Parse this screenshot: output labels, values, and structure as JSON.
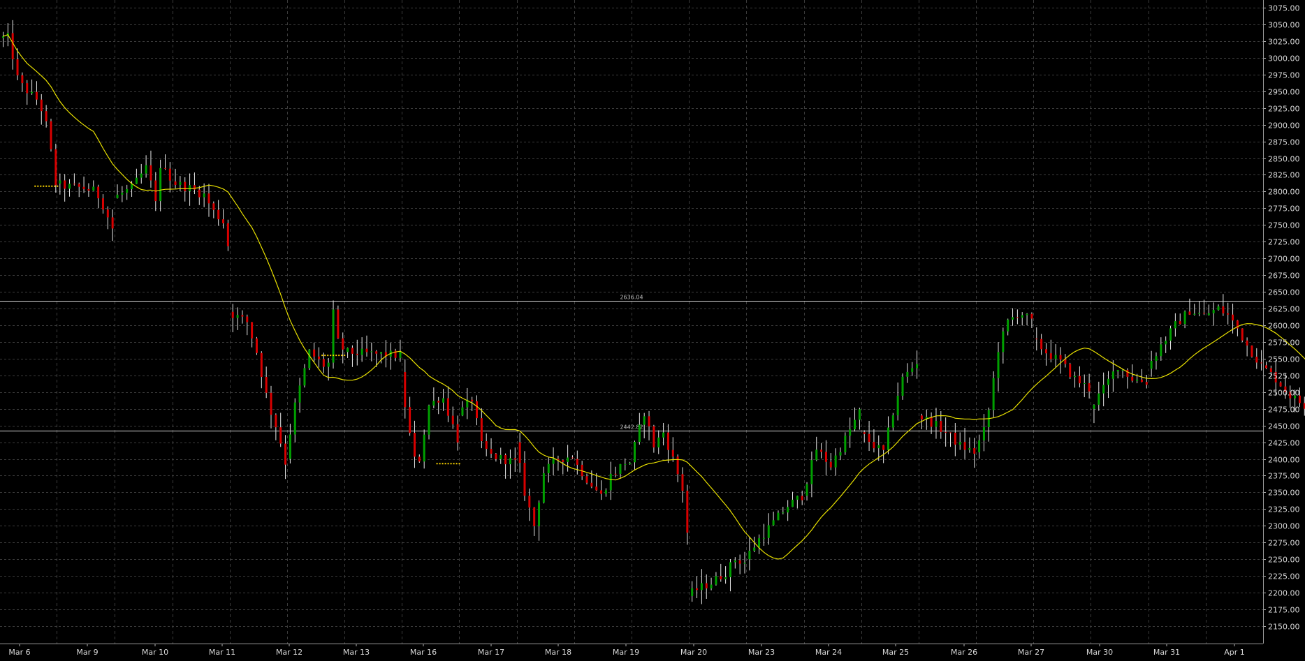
{
  "colors": {
    "background": "#000000",
    "grid": "#3c3c3c",
    "bull": "#00a000",
    "bear": "#d80000",
    "wick": "#e8e8e8",
    "ma": "#e8e000",
    "gap": "#ffd800",
    "level": "#d8d8d8",
    "axis_text": "#d8d8d8"
  },
  "chart_data": {
    "type": "candlestick",
    "ylim": [
      2150,
      3075
    ],
    "y_ticks": [
      "3075.00",
      "3050.00",
      "3025.00",
      "3000.00",
      "2975.00",
      "2950.00",
      "2925.00",
      "2900.00",
      "2875.00",
      "2850.00",
      "2825.00",
      "2800.00",
      "2775.00",
      "2750.00",
      "2725.00",
      "2700.00",
      "2675.00",
      "2650.00",
      "2625.00",
      "2600.00",
      "2575.00",
      "2550.00",
      "2525.00",
      "2500.00",
      "2475.00",
      "2450.00",
      "2425.00",
      "2400.00",
      "2375.00",
      "2350.00",
      "2325.00",
      "2300.00",
      "2275.00",
      "2250.00",
      "2225.00",
      "2200.00",
      "2175.00",
      "2150.00"
    ],
    "sessions": [
      "Mar 6",
      "Mar 9",
      "Mar 10",
      "Mar 11",
      "Mar 12",
      "Mar 13",
      "Mar 16",
      "Mar 17",
      "Mar 18",
      "Mar 19",
      "Mar 20",
      "Mar 23",
      "Mar 24",
      "Mar 25",
      "Mar 26",
      "Mar 27",
      "Mar 30",
      "Mar 31",
      "Apr 1"
    ],
    "horizontal_lines": [
      {
        "value": 2636.04,
        "label": "2636.04"
      },
      {
        "value": 2442.82,
        "label": "2442.82"
      }
    ],
    "session_path": [
      [
        [
          2.5,
          3030
        ],
        [
          3.5,
          2975
        ],
        [
          5,
          2958
        ],
        [
          6.8,
          2945
        ],
        [
          8.5,
          2935
        ],
        [
          10,
          2900
        ],
        [
          11.7,
          2830
        ],
        [
          12,
          2812
        ]
      ],
      [
        [
          0,
          2812
        ],
        [
          2,
          2808
        ],
        [
          6,
          2805
        ],
        [
          8.5,
          2800
        ],
        [
          10,
          2780
        ],
        [
          12,
          2745
        ]
      ],
      [
        [
          0,
          2790
        ],
        [
          4,
          2805
        ],
        [
          7,
          2835
        ],
        [
          9,
          2790
        ],
        [
          10.5,
          2850
        ],
        [
          12,
          2820
        ]
      ],
      [
        [
          0,
          2815
        ],
        [
          4,
          2805
        ],
        [
          7,
          2795
        ],
        [
          9,
          2770
        ],
        [
          11,
          2755
        ],
        [
          12,
          2720
        ]
      ],
      [
        [
          0,
          2620
        ],
        [
          4,
          2605
        ],
        [
          6,
          2560
        ],
        [
          8.5,
          2480
        ],
        [
          10.5,
          2440
        ],
        [
          12,
          2395
        ]
      ],
      [
        [
          0,
          2400
        ],
        [
          2,
          2480
        ],
        [
          5,
          2560
        ],
        [
          8,
          2540
        ],
        [
          9.8,
          2545
        ],
        [
          10.2,
          2690
        ],
        [
          11,
          2575
        ],
        [
          12,
          2565
        ]
      ],
      [
        [
          0,
          2560
        ],
        [
          6,
          2557
        ],
        [
          12,
          2555
        ]
      ],
      [
        [
          0,
          2530
        ],
        [
          1.5,
          2455
        ],
        [
          3.5,
          2380
        ],
        [
          6,
          2480
        ],
        [
          8.8,
          2495
        ],
        [
          10,
          2470
        ],
        [
          12,
          2430
        ]
      ],
      [
        [
          0,
          2465
        ],
        [
          3,
          2490
        ],
        [
          5,
          2420
        ],
        [
          7,
          2405
        ],
        [
          9.5,
          2400
        ],
        [
          12,
          2395
        ]
      ],
      [
        [
          0,
          2425
        ],
        [
          2,
          2350
        ],
        [
          4,
          2300
        ],
        [
          6,
          2380
        ],
        [
          9,
          2400
        ],
        [
          12,
          2405
        ]
      ],
      [
        [
          0,
          2400
        ],
        [
          3,
          2370
        ],
        [
          6,
          2345
        ],
        [
          8,
          2375
        ],
        [
          11,
          2395
        ],
        [
          12,
          2395
        ]
      ],
      [
        [
          0,
          2395
        ],
        [
          3,
          2470
        ],
        [
          5,
          2420
        ],
        [
          7,
          2440
        ],
        [
          9,
          2400
        ],
        [
          11,
          2355
        ],
        [
          12,
          2290
        ]
      ],
      [
        [
          0,
          2195
        ],
        [
          2,
          2205
        ],
        [
          5,
          2215
        ],
        [
          8,
          2230
        ],
        [
          10,
          2250
        ],
        [
          12,
          2245
        ]
      ],
      [
        [
          0,
          2250
        ],
        [
          3,
          2280
        ],
        [
          6,
          2305
        ],
        [
          9,
          2330
        ],
        [
          12,
          2345
        ]
      ],
      [
        [
          0,
          2345
        ],
        [
          3,
          2415
        ],
        [
          6,
          2390
        ],
        [
          9,
          2430
        ],
        [
          12,
          2470
        ]
      ],
      [
        [
          0,
          2440
        ],
        [
          3,
          2420
        ],
        [
          5,
          2410
        ],
        [
          7.5,
          2485
        ],
        [
          9,
          2520
        ],
        [
          12,
          2545
        ]
      ],
      [
        [
          0,
          2465
        ],
        [
          3,
          2455
        ],
        [
          6,
          2440
        ],
        [
          9,
          2420
        ],
        [
          12,
          2410
        ]
      ],
      [
        [
          0,
          2410
        ],
        [
          2.5,
          2450
        ],
        [
          5,
          2565
        ],
        [
          7,
          2605
        ],
        [
          9.5,
          2620
        ],
        [
          12,
          2605
        ]
      ],
      [
        [
          0,
          2580
        ],
        [
          3,
          2560
        ],
        [
          6,
          2545
        ],
        [
          9,
          2520
        ],
        [
          11,
          2510
        ],
        [
          12,
          2505
        ]
      ],
      [
        [
          0,
          2475
        ],
        [
          3,
          2505
        ],
        [
          6,
          2540
        ],
        [
          9,
          2520
        ],
        [
          12,
          2515
        ]
      ],
      [
        [
          0,
          2535
        ],
        [
          3,
          2570
        ],
        [
          6,
          2600
        ],
        [
          9,
          2622
        ],
        [
          12,
          2615
        ]
      ],
      [
        [
          0,
          2615
        ],
        [
          3,
          2625
        ],
        [
          5,
          2615
        ],
        [
          7,
          2595
        ],
        [
          9,
          2570
        ],
        [
          12,
          2540
        ]
      ],
      [
        [
          0,
          2540
        ],
        [
          3,
          2520
        ],
        [
          6,
          2495
        ],
        [
          9,
          2480
        ],
        [
          12,
          2470
        ]
      ]
    ],
    "gap_segments": [
      {
        "from_session": 0,
        "to_session": 1,
        "value": 2808
      },
      {
        "from_session": 5,
        "to_session": 6,
        "value": 2555
      },
      {
        "from_session": 7,
        "to_session": 8,
        "value": 2393
      }
    ],
    "moving_average": {
      "period": 20
    }
  }
}
